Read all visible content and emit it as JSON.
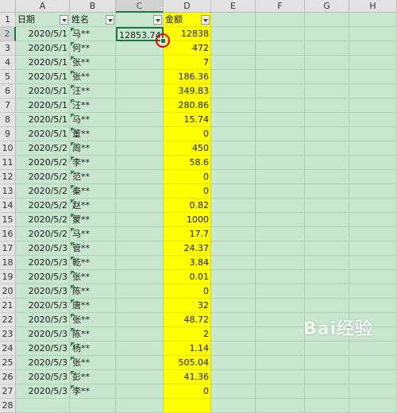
{
  "columns": [
    "A",
    "B",
    "C",
    "D",
    "E",
    "F",
    "G",
    "H"
  ],
  "headers": {
    "A": "日期",
    "B": "姓名",
    "C": "",
    "D": "金额"
  },
  "selected_cell_value": "12853.74",
  "rows": [
    {
      "n": "1"
    },
    {
      "n": "2",
      "date": "2020/5/1",
      "name": "马**",
      "amount": "12838"
    },
    {
      "n": "3",
      "date": "2020/5/1",
      "name": "何**",
      "amount": "472"
    },
    {
      "n": "4",
      "date": "2020/5/1",
      "name": "张**",
      "amount": "7"
    },
    {
      "n": "5",
      "date": "2020/5/1",
      "name": "张**",
      "amount": "186.36"
    },
    {
      "n": "6",
      "date": "2020/5/1",
      "name": "汪**",
      "amount": "349.83"
    },
    {
      "n": "7",
      "date": "2020/5/1",
      "name": "汪**",
      "amount": "280.86"
    },
    {
      "n": "8",
      "date": "2020/5/1",
      "name": "马**",
      "amount": "15.74"
    },
    {
      "n": "9",
      "date": "2020/5/1",
      "name": "董**",
      "amount": "0"
    },
    {
      "n": "10",
      "date": "2020/5/2",
      "name": "周**",
      "amount": "450"
    },
    {
      "n": "11",
      "date": "2020/5/2",
      "name": "李**",
      "amount": "58.6"
    },
    {
      "n": "12",
      "date": "2020/5/2",
      "name": "范**",
      "amount": "0"
    },
    {
      "n": "13",
      "date": "2020/5/2",
      "name": "秦**",
      "amount": "0"
    },
    {
      "n": "14",
      "date": "2020/5/2",
      "name": "赵**",
      "amount": "0.82"
    },
    {
      "n": "15",
      "date": "2020/5/2",
      "name": "蒙**",
      "amount": "1000"
    },
    {
      "n": "16",
      "date": "2020/5/2",
      "name": "马**",
      "amount": "17.7"
    },
    {
      "n": "17",
      "date": "2020/5/3",
      "name": "管**",
      "amount": "24.37"
    },
    {
      "n": "18",
      "date": "2020/5/3",
      "name": "乾**",
      "amount": "3.84"
    },
    {
      "n": "19",
      "date": "2020/5/3",
      "name": "张**",
      "amount": "0.01"
    },
    {
      "n": "20",
      "date": "2020/5/3",
      "name": "陈**",
      "amount": "0"
    },
    {
      "n": "21",
      "date": "2020/5/3",
      "name": "唐**",
      "amount": "32"
    },
    {
      "n": "22",
      "date": "2020/5/3",
      "name": "张**",
      "amount": "48.72"
    },
    {
      "n": "23",
      "date": "2020/5/3",
      "name": "陈**",
      "amount": "2"
    },
    {
      "n": "24",
      "date": "2020/5/3",
      "name": "杨**",
      "amount": "1.14"
    },
    {
      "n": "25",
      "date": "2020/5/3",
      "name": "张**",
      "amount": "505.04"
    },
    {
      "n": "26",
      "date": "2020/5/3",
      "name": "彭**",
      "amount": "41.36"
    },
    {
      "n": "27",
      "date": "2020/5/3",
      "name": "李**",
      "amount": "0"
    },
    {
      "n": "28"
    }
  ],
  "watermark": "Bai经验",
  "colors": {
    "sheet_bg": "#c7e8cf",
    "highlight": "#ffff00",
    "selection": "#217346",
    "annotation_circle": "#e00000"
  },
  "icons": [
    "filter-dropdown-icon",
    "error-triangle-icon",
    "fill-handle",
    "annotation-circle"
  ]
}
